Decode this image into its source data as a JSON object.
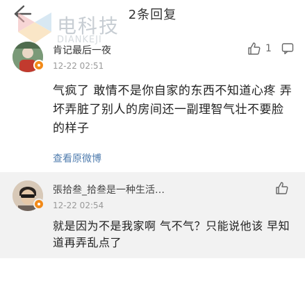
{
  "header": {
    "title": "2条回复",
    "back_icon": "back-arrow-icon"
  },
  "watermark": {
    "text": "电科技",
    "subtext": "DIANKEJI"
  },
  "main_comment": {
    "username": "肯记最后一夜",
    "time": "12-22 02:51",
    "like_count": "1",
    "body": "气疯了 敢情不是你自家的东西不知道心疼 弄坏弄脏了别人的房间还一副理智气壮不要脸的样子",
    "view_original": "查看原微博"
  },
  "reply_comment": {
    "username": "張拾叁_拾叁是一种生活…",
    "time": "12-22 02:54",
    "body": "就是因为不是我家啊 气不气？只能说他该 早知道再弄乱点了"
  },
  "colors": {
    "link": "#507daf",
    "verify_badge": "#f28a19",
    "reply_background": "#f2f2f2"
  }
}
